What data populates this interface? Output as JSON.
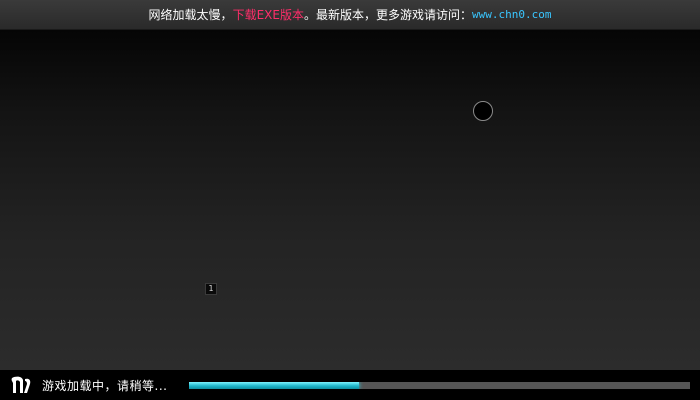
{
  "notice": {
    "lead_text": "网络加载太慢，",
    "download_link": "下载EXE版本",
    "mid_text": "。最新版本，更多游戏请访问：",
    "site_url": "www.chn0.com"
  },
  "stage": {
    "marker_label": "1",
    "ring_icon": "ring-icon"
  },
  "loading": {
    "logo_icon": "game-logo-icon",
    "status_text": "游戏加载中，请稍等...",
    "progress_fraction": 0.34,
    "accent_color": "#1fb8cc",
    "download_color": "#ff2d6a",
    "url_color": "#39c6ff"
  }
}
